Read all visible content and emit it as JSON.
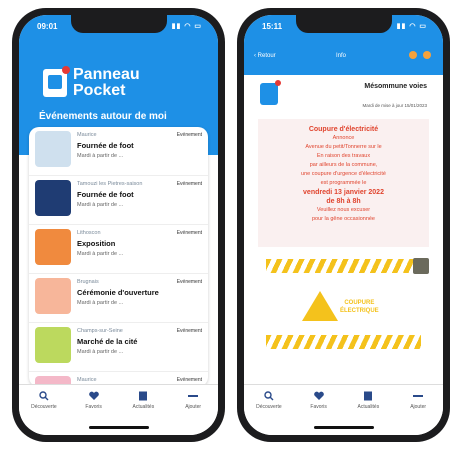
{
  "status": {
    "time_left": "09:01",
    "time_right": "15:11",
    "icons": "▮▮ ◠ ▭"
  },
  "left": {
    "app_name": [
      "Panneau",
      "Pocket"
    ],
    "section_title": "Événements autour de moi",
    "events": [
      {
        "commune": "Maurice",
        "title": "Fournée de foot",
        "date": "Mardi à partir de ...",
        "badge": "Evénement",
        "thumb_color": "#cfe0ee"
      },
      {
        "commune": "Tamouzi les Pietres-saison",
        "title": "Fournée de foot",
        "date": "Mardi à partir de ...",
        "badge": "Evénement",
        "thumb_color": "#1f3c73"
      },
      {
        "commune": "Lithoscon",
        "title": "Exposition",
        "date": "Mardi à partir de ...",
        "badge": "Evénement",
        "thumb_color": "#f08a3e"
      },
      {
        "commune": "Brugnais",
        "title": "Cérémonie d'ouverture",
        "date": "Mardi à partir de ...",
        "badge": "Evénement",
        "thumb_color": "#f7b69a"
      },
      {
        "commune": "Champs-sur-Seine",
        "title": "Marché de la cité",
        "date": "Mardi à partir de ...",
        "badge": "Evénement",
        "thumb_color": "#bcd95e"
      },
      {
        "commune": "Maurice",
        "title": "",
        "date": "",
        "badge": "Evénement",
        "thumb_color": "#f4b8c8"
      }
    ]
  },
  "right": {
    "nav_back": "‹ Retour",
    "nav_title": "Info",
    "commune": "Mésommune voies",
    "updated": "Mardi de mise à jour 15/01/2023",
    "notice_lines": [
      {
        "text": "Coupure d'électricité",
        "bold": true
      },
      {
        "text": "Annonce",
        "bold": false
      },
      {
        "text": "Avenue du petit/Tonnerre sur le",
        "bold": false
      },
      {
        "text": "En raison des travaux",
        "bold": false
      },
      {
        "text": "par ailleurs de la commune,",
        "bold": false
      },
      {
        "text": "une coupure d'urgence d'électricité",
        "bold": false
      },
      {
        "text": "est programmée le",
        "bold": false
      },
      {
        "text": "vendredi 13 janvier 2022",
        "bold": true
      },
      {
        "text": "de 8h à 8h",
        "bold": true
      },
      {
        "text": "Veuillez nous excuser",
        "bold": false
      },
      {
        "text": "pour la gêne occasionnée",
        "bold": false
      }
    ],
    "warning_text": [
      "COUPURE",
      "ÉLECTRIQUE"
    ]
  },
  "tabs": [
    {
      "label": "Découverte",
      "icon": "search-icon"
    },
    {
      "label": "Favoris",
      "icon": "heart-icon"
    },
    {
      "label": "Actualités",
      "icon": "newspaper-icon"
    },
    {
      "label": "Ajouter",
      "icon": "menu-icon"
    }
  ]
}
